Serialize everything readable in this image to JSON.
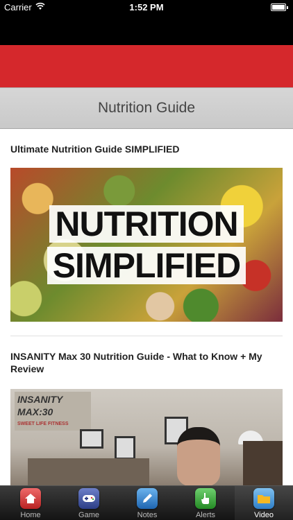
{
  "status_bar": {
    "carrier": "Carrier",
    "time": "1:52 PM"
  },
  "header": {
    "title": "Nutrition Guide",
    "banner_color": "#d5282c"
  },
  "videos": [
    {
      "title": "Ultimate Nutrition Guide SIMPLIFIED",
      "thumbnail_text": [
        "NUTRITION",
        "SIMPLIFIED"
      ]
    },
    {
      "title": "INSANITY Max 30 Nutrition Guide - What to Know + My Review",
      "thumbnail_logo": "INSANITY MAX:30",
      "thumbnail_logo_sub": "SWEET LIFE FITNESS"
    }
  ],
  "tab_bar": {
    "tabs": [
      {
        "label": "Home",
        "icon": "home-icon",
        "color": "#d23a3a"
      },
      {
        "label": "Game",
        "icon": "gamepad-icon",
        "color": "#3a4f9c"
      },
      {
        "label": "Notes",
        "icon": "pen-icon",
        "color": "#2f7fc8"
      },
      {
        "label": "Alerts",
        "icon": "hand-pointer-icon",
        "color": "#3aa33a"
      },
      {
        "label": "Video",
        "icon": "folder-icon",
        "color": "#f2b01e"
      }
    ],
    "active": "Video"
  }
}
